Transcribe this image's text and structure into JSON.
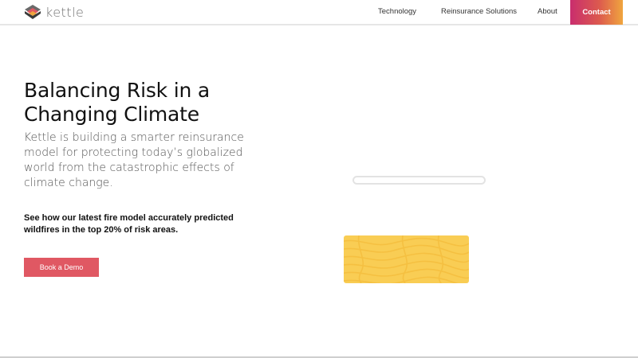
{
  "brand": {
    "name": "kettle",
    "logo_icon": "layered-diamond-icon"
  },
  "nav": {
    "items": [
      {
        "label": "Technology"
      },
      {
        "label": "Reinsurance Solutions"
      },
      {
        "label": "About"
      }
    ],
    "contact_label": "Contact"
  },
  "hero": {
    "title": "Balancing Risk in a Changing Climate",
    "subtitle": "Kettle is building a smarter reinsurance model for protecting today’s globalized world from the catastrophic effects of climate change.",
    "callout": "See how our latest fire model accurately predicted wildfires in the top 20% of risk areas.",
    "cta_label": "Book a Demo"
  },
  "colors": {
    "cta": "#e05863",
    "contact_gradient_start": "#c92d6e",
    "contact_gradient_end": "#f0a53e",
    "card": "#f9cd54"
  }
}
